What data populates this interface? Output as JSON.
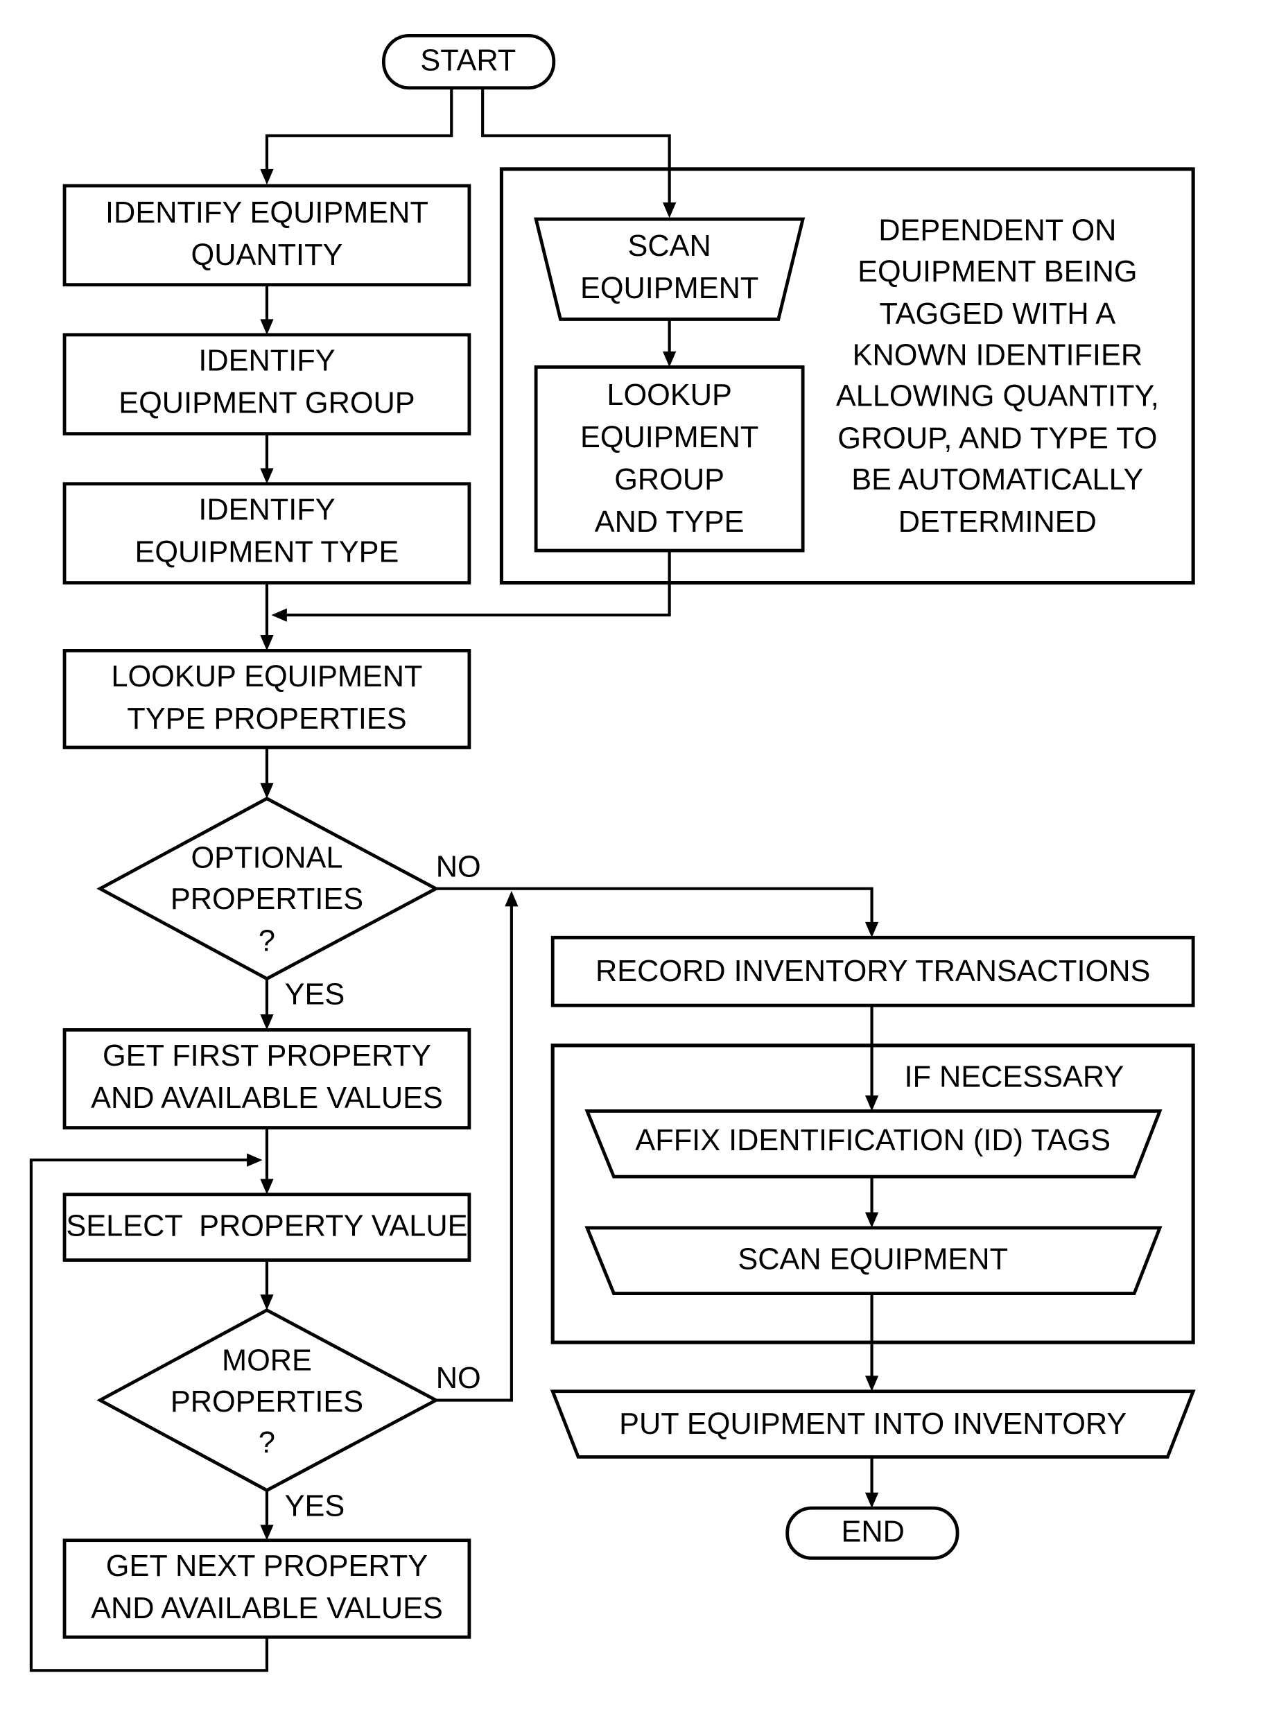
{
  "flowchart": {
    "start": "START",
    "end": "END",
    "identify_quantity": [
      "IDENTIFY EQUIPMENT",
      "QUANTITY"
    ],
    "identify_group": [
      "IDENTIFY",
      "EQUIPMENT GROUP"
    ],
    "identify_type": [
      "IDENTIFY",
      "EQUIPMENT TYPE"
    ],
    "scan_equipment_top": [
      "SCAN",
      "EQUIPMENT"
    ],
    "lookup_group_type": [
      "LOOKUP",
      "EQUIPMENT",
      "GROUP",
      "AND TYPE"
    ],
    "dependency_note": [
      "DEPENDENT ON",
      "EQUIPMENT BEING",
      "TAGGED WITH A",
      "KNOWN IDENTIFIER",
      "ALLOWING QUANTITY,",
      "GROUP, AND TYPE TO",
      "BE AUTOMATICALLY",
      "DETERMINED"
    ],
    "lookup_type_properties": [
      "LOOKUP EQUIPMENT",
      "TYPE PROPERTIES"
    ],
    "optional_properties": [
      "OPTIONAL",
      "PROPERTIES",
      "?"
    ],
    "get_first_property": [
      "GET FIRST PROPERTY",
      "AND AVAILABLE VALUES"
    ],
    "select_property_value": "SELECT  PROPERTY VALUE",
    "more_properties": [
      "MORE",
      "PROPERTIES",
      "?"
    ],
    "get_next_property": [
      "GET NEXT PROPERTY",
      "AND AVAILABLE VALUES"
    ],
    "record_transactions": "RECORD INVENTORY TRANSACTIONS",
    "if_necessary": "IF NECESSARY",
    "affix_tags": "AFFIX IDENTIFICATION (ID) TAGS",
    "scan_equipment_bottom": "SCAN EQUIPMENT",
    "put_into_inventory": "PUT EQUIPMENT INTO INVENTORY",
    "labels": {
      "no": "NO",
      "yes": "YES"
    }
  }
}
